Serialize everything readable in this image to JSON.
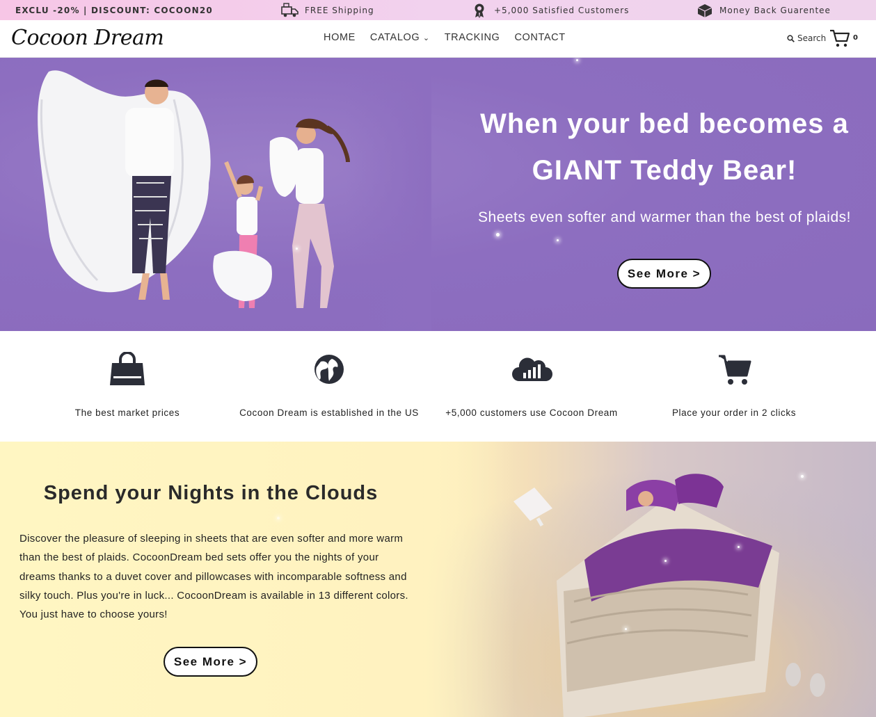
{
  "topbar": {
    "promo": "EXCLU -20% | DISCOUNT: COCOON20",
    "shipping": "FREE Shipping",
    "customers": "+5,000 Satisfied Customers",
    "guarantee": "Money Back Guarentee"
  },
  "header": {
    "logo": "Cocoon Dream",
    "nav": [
      "HOME",
      "CATALOG",
      "TRACKING",
      "CONTACT"
    ],
    "search_label": "Search",
    "cart_count": "0"
  },
  "hero": {
    "title_line1": "When your bed becomes a",
    "title_line2": "GIANT Teddy Bear!",
    "subtitle": "Sheets even softer and warmer than the best of plaids!",
    "button": "See More >"
  },
  "features": [
    {
      "icon": "shopping-bag-icon",
      "text": "The best market prices"
    },
    {
      "icon": "globe-icon",
      "text": "Cocoon Dream is established in the US"
    },
    {
      "icon": "cloud-chart-icon",
      "text": "+5,000 customers use Cocoon Dream"
    },
    {
      "icon": "cart-icon",
      "text": "Place your order in 2 clicks"
    }
  ],
  "clouds": {
    "title": "Spend your Nights in the Clouds",
    "body": "Discover the pleasure of sleeping in sheets that are even softer and more warm than the best of plaids. CocoonDream bed sets offer you the nights of your dreams thanks to a duvet cover and pillowcases with incomparable softness and silky touch. Plus you're in luck... CocoonDream is available in 13 different colors. You just have to choose yours!",
    "button": "See More >"
  },
  "colors": {
    "hero_bg": "#8d6ec0",
    "topbar_bg": "#f7c6e6",
    "clouds_bg": "#fff6c2",
    "icon": "#2b2e38"
  }
}
